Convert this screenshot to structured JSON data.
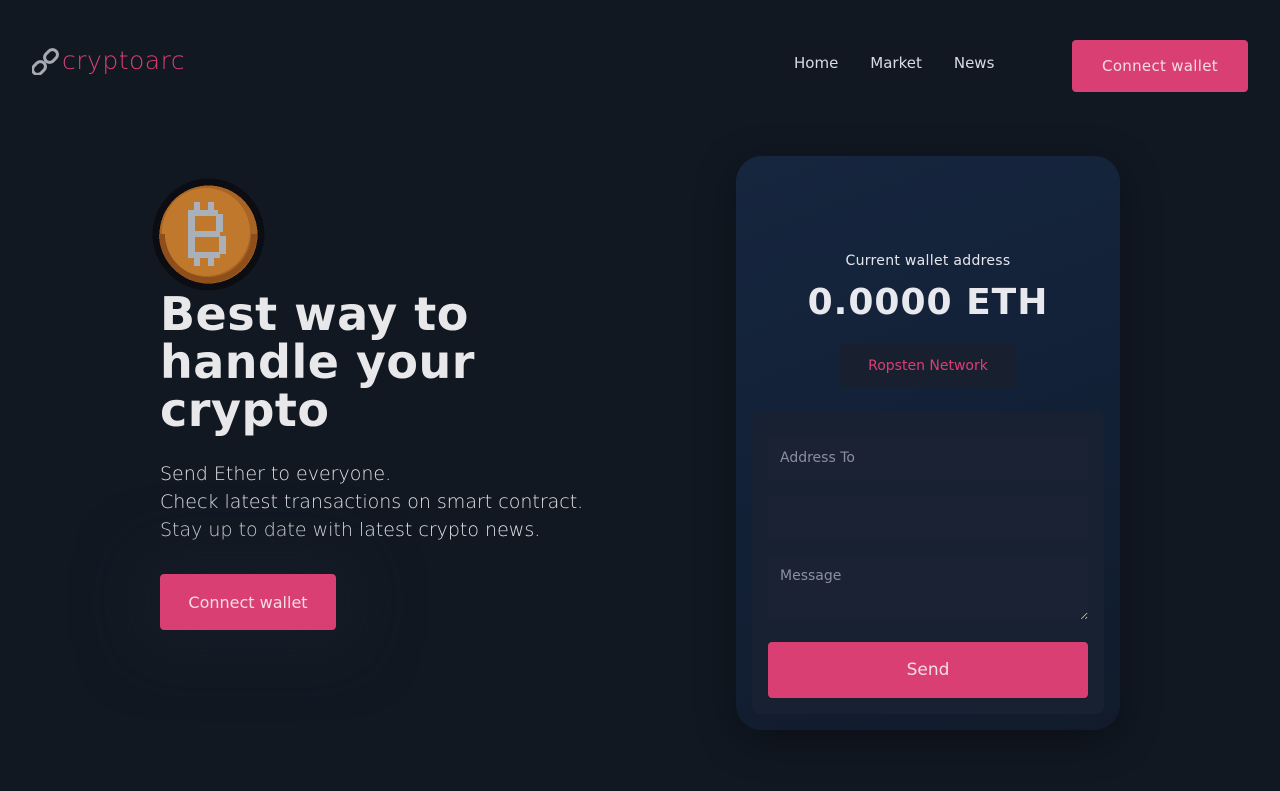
{
  "header": {
    "logo_text": "cryptoarc",
    "logo_icon": "link-icon",
    "nav": [
      {
        "label": "Home"
      },
      {
        "label": "Market"
      },
      {
        "label": "News"
      }
    ],
    "connect_label": "Connect wallet"
  },
  "hero": {
    "icon": "bitcoin-coin-icon",
    "headline": "Best way to handle your crypto",
    "lines": [
      "Send Ether to everyone.",
      "Check latest transactions on smart contract.",
      "Stay up to date with latest crypto news."
    ],
    "connect_label": "Connect wallet"
  },
  "wallet": {
    "label": "Current wallet address",
    "balance": "0.0000 ETH",
    "network": "Ropsten Network",
    "form": {
      "address_placeholder": "Address To",
      "amount_placeholder": "",
      "message_placeholder": "Message",
      "send_label": "Send"
    }
  },
  "colors": {
    "background": "#111822",
    "accent": "#d93f72",
    "card": "#16263e"
  }
}
